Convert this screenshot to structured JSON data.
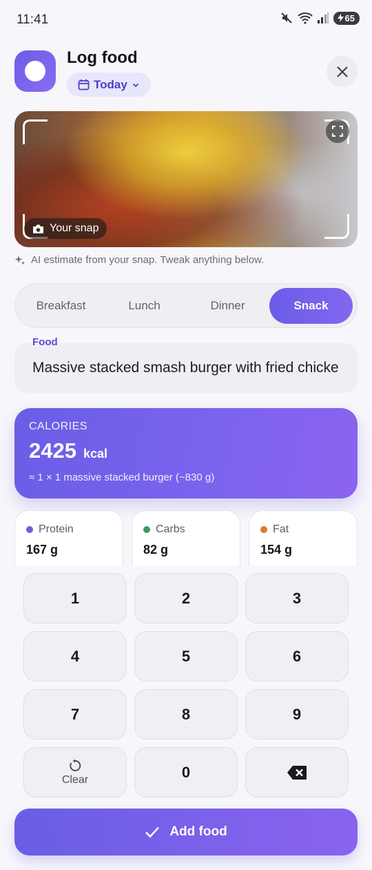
{
  "status": {
    "time": "11:41",
    "battery": "65"
  },
  "header": {
    "title": "Log food",
    "date_label": "Today"
  },
  "photo": {
    "badge_label": "Your snap"
  },
  "ai_note": "AI estimate from your snap. Tweak anything below.",
  "meal_tabs": [
    {
      "label": "Breakfast",
      "active": false
    },
    {
      "label": "Lunch",
      "active": false
    },
    {
      "label": "Dinner",
      "active": false
    },
    {
      "label": "Snack",
      "active": true
    }
  ],
  "food": {
    "label": "Food",
    "value": "Massive stacked smash burger with fried chicken"
  },
  "calories": {
    "label": "CALORIES",
    "value": "2425",
    "unit": "kcal",
    "portion": "≈ 1 × 1 massive stacked burger (~830 g)"
  },
  "macros": [
    {
      "label": "Protein",
      "value": "167 g",
      "color": "#7b57e0"
    },
    {
      "label": "Carbs",
      "value": "82 g",
      "color": "#3a9a62"
    },
    {
      "label": "Fat",
      "value": "154 g",
      "color": "#e0782f"
    }
  ],
  "keypad": {
    "keys": [
      "1",
      "2",
      "3",
      "4",
      "5",
      "6",
      "7",
      "8",
      "9"
    ],
    "clear_label": "Clear",
    "zero": "0"
  },
  "add_button": {
    "label": "Add food"
  }
}
